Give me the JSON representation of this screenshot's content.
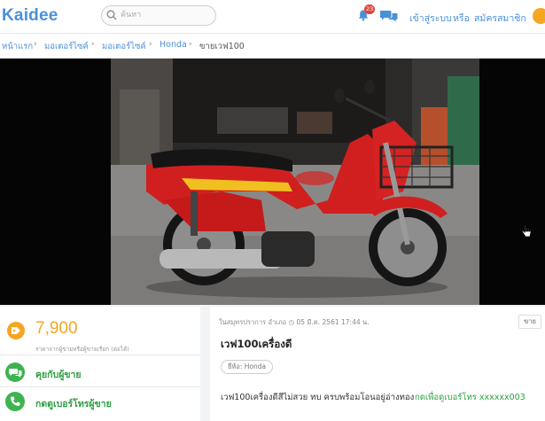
{
  "header": {
    "logo": "Kaidee",
    "search_placeholder": "ค้นหา",
    "notification_count": "23",
    "login": "เข้าสู่ระบบ",
    "or": "หรือ",
    "signup": "สมัครสมาชิก"
  },
  "breadcrumb": {
    "items": [
      "หน้าแรก",
      "มอเตอร์ไซค์",
      "มอเตอร์ไซค์",
      "Honda",
      "ขายเวฟ100"
    ]
  },
  "listing": {
    "price": "7,900",
    "price_note": "ราคาจากผู้ขายหรือผู้ขายเรียก (ต่อได้)",
    "chat_button": "คุยกับผู้ขาย",
    "phone_button": "กดดูเบอร์โทรผู้ขาย",
    "meta": "ในสมุทรปราการ อำเภอ  ◷ 05 มี.ค. 2561 17:44 น.",
    "sale_tag": "ขาย",
    "title": "เวฟ100เครื่องดี",
    "brand_chip": "ยี่ห้อ: Honda",
    "description": "เวฟ100เครื่องดีสีไม่สวย ทบ ครบพร้อมโอนอยู่อ่างทอง",
    "phone_link": "กดเพื่อดูเบอร์โทร xxxxxx003"
  },
  "colors": {
    "brand_blue": "#4a90d9",
    "price_orange": "#f5a623",
    "action_green": "#2e9e42"
  }
}
